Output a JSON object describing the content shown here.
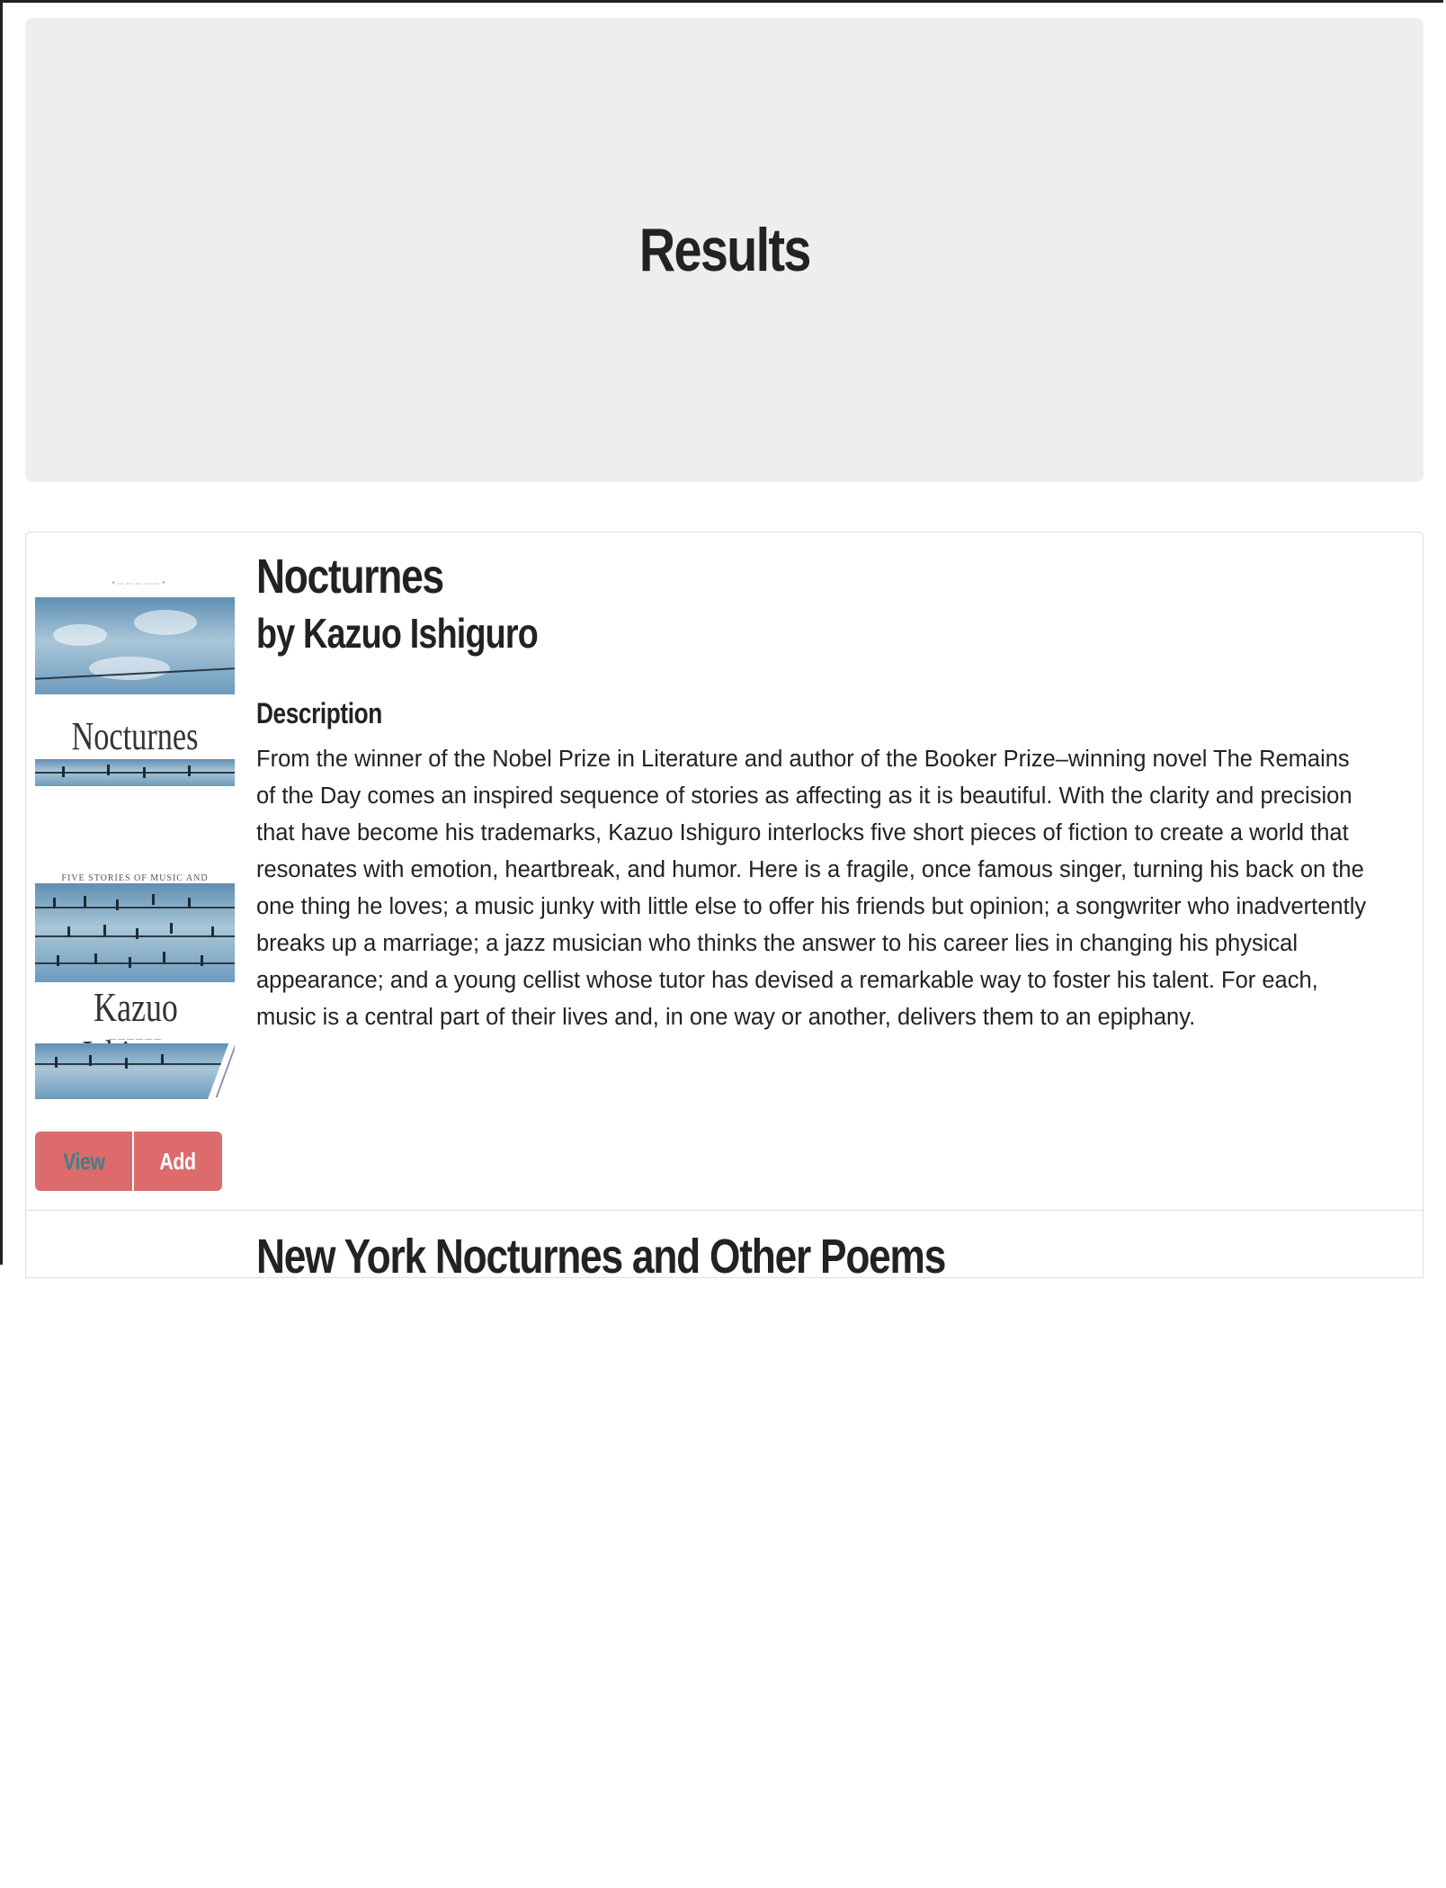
{
  "page": {
    "heading": "Results"
  },
  "results": [
    {
      "title": "Nocturnes",
      "author_line": "by Kazuo Ishiguro",
      "description_heading": "Description",
      "description": "From the winner of the Nobel Prize in Literature and author of the Booker Prize–winning novel The Remains of the Day comes an inspired sequence of stories as affecting as it is beautiful. With the clarity and precision that have become his trademarks, Kazuo Ishiguro interlocks five short pieces of fiction to create a world that resonates with emotion, heartbreak, and humor. Here is a fragile, once famous singer, turning his back on the one thing he loves; a music junky with little else to offer his friends but opinion; a songwriter who inadvertently breaks up a marriage; a jazz musician who thinks the answer to his career lies in changing his physical appearance; and a young cellist whose tutor has devised a remarkable way to foster his talent. For each, music is a central part of their lives and, in one way or another, delivers them to an epiphany.",
      "cover": {
        "title_text": "Nocturnes",
        "subtitle_text": "FIVE STORIES OF MUSIC AND NIGHTFALL",
        "author_text": "Kazuo Ishiguro"
      },
      "buttons": {
        "view_label": "View",
        "add_label": "Add"
      },
      "colors": {
        "button_bg": "#dd6b6b",
        "view_text": "#3f7f86",
        "add_text": "#ffffff"
      }
    },
    {
      "title": "New York Nocturnes and Other Poems"
    }
  ],
  "colors": {
    "jumbotron_bg": "#eeeeee",
    "text": "#222222",
    "border": "#dddddd"
  }
}
